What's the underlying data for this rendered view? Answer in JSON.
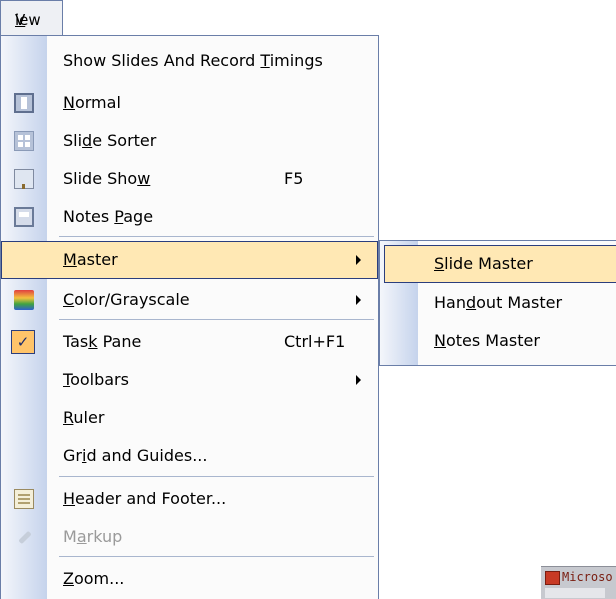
{
  "menubar": {
    "view_label": "View"
  },
  "menu": {
    "items": [
      {
        "label": "Show Slides And Record Timings"
      },
      {
        "label": "Normal",
        "icon": "normal-view-icon"
      },
      {
        "label": "Slide Sorter",
        "icon": "slide-sorter-icon"
      },
      {
        "label": "Slide Show",
        "shortcut": "F5",
        "icon": "slide-show-icon"
      },
      {
        "label": "Notes Page",
        "icon": "notes-page-icon"
      },
      {
        "label": "Master",
        "has_submenu": true,
        "highlighted": true
      },
      {
        "label": "Color/Grayscale",
        "has_submenu": true,
        "icon": "color-grayscale-icon"
      },
      {
        "label": "Task Pane",
        "shortcut": "Ctrl+F1",
        "checked": true,
        "icon": "check-icon"
      },
      {
        "label": "Toolbars",
        "has_submenu": true
      },
      {
        "label": "Ruler"
      },
      {
        "label": "Grid and Guides..."
      },
      {
        "label": "Header and Footer...",
        "icon": "header-footer-icon"
      },
      {
        "label": "Markup",
        "disabled": true,
        "icon": "markup-icon"
      },
      {
        "label": "Zoom..."
      }
    ]
  },
  "submenu": {
    "items": [
      {
        "label": "Slide Master",
        "highlighted": true
      },
      {
        "label": "Handout Master"
      },
      {
        "label": "Notes Master"
      }
    ]
  },
  "taskbar": {
    "title": "Microso"
  },
  "colors": {
    "highlight_bg": "#ffe8b4",
    "highlight_border": "#2b3e7d",
    "menu_border": "#6a7ea8",
    "check_bg": "#ffc46a"
  }
}
